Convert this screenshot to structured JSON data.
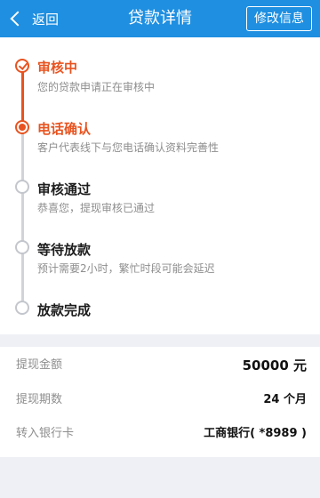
{
  "header": {
    "back_label": "返回",
    "title": "贷款详情",
    "edit_label": "修改信息",
    "background": "#1e8fe1"
  },
  "colors": {
    "accent": "#e8531f",
    "pending": "#c3c6cc"
  },
  "steps": [
    {
      "title": "审核中",
      "desc": "您的贷款申请正在审核中",
      "state": "done",
      "icon": "check-circle-icon"
    },
    {
      "title": "电话确认",
      "desc": "客户代表线下与您电话确认资料完善性",
      "state": "active",
      "icon": "dot-circle-icon"
    },
    {
      "title": "审核通过",
      "desc": "恭喜您，提现审核已通过",
      "state": "pending",
      "icon": "empty-circle-icon"
    },
    {
      "title": "等待放款",
      "desc": "预计需要2小时，繁忙时段可能会延迟",
      "state": "pending",
      "icon": "empty-circle-icon"
    },
    {
      "title": "放款完成",
      "desc": "",
      "state": "pending",
      "icon": "empty-circle-icon"
    }
  ],
  "details": [
    {
      "label": "提现金额",
      "value": "50000 元"
    },
    {
      "label": "提现期数",
      "value": "24 个月"
    },
    {
      "label": "转入银行卡",
      "value": "工商银行( *8989 )"
    }
  ]
}
